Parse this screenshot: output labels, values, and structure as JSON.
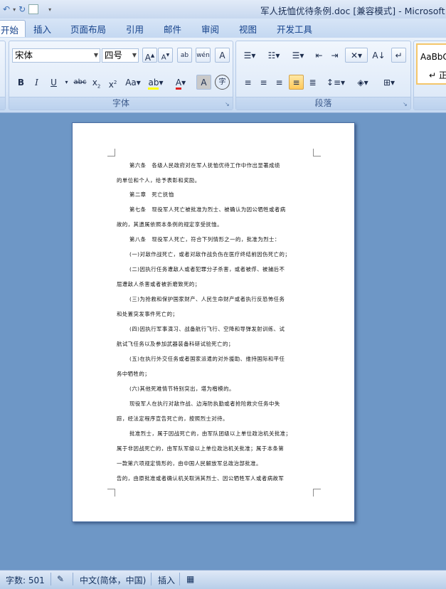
{
  "window": {
    "title": "军人抚恤优待条例.doc [兼容模式] - Microsoft W"
  },
  "tabs": [
    {
      "label": "开始"
    },
    {
      "label": "插入"
    },
    {
      "label": "页面布局"
    },
    {
      "label": "引用"
    },
    {
      "label": "邮件"
    },
    {
      "label": "审阅"
    },
    {
      "label": "视图"
    },
    {
      "label": "开发工具"
    }
  ],
  "ribbon": {
    "font_group_label": "字体",
    "paragraph_group_label": "段落",
    "font_name": "宋体",
    "font_size": "四号",
    "styles_preview": "AaBbC",
    "styles_name": "↵ 正"
  },
  "document": {
    "lines": [
      "第六条　各级人民政府对在军人抚恤优待工作中作出显著成绩",
      "的单位和个人，给予表彰和奖励。",
      "第二章　死亡抚恤",
      "第七条　现役军人死亡被批准为烈士、被确认为因公牺牲或者病",
      "故的，其遗属依照本条例的规定享受抚恤。",
      "第八条　现役军人死亡，符合下列情形之一的，批准为烈士：",
      "(一)对敌作战死亡，或者对敌作战负伤在医疗终结前因伤死亡的；",
      "(二)因执行任务遭敌人或者犯罪分子杀害，或者被俘、被捕后不",
      "屈遭敌人杀害或者被折磨致死的；",
      "(三)为抢救和保护国家财产、人民生命财产或者执行反恐怖任务",
      "和处置突发事件死亡的；",
      "(四)因执行军事演习、战备航行飞行、空降和导弹发射训练、试",
      "航试飞任务以及参加武器装备科研试验死亡的；",
      "(五)在执行外交任务或者国家派遣的对外援助、维持国际和平任",
      "务中牺牲的；",
      "(六)其他死难情节特别突出，堪为楷模的。",
      "现役军人在执行对敌作战、边海防执勤或者抢险救灾任务中失",
      "踪，经法定程序宣告死亡的，按照烈士对待。",
      "批准烈士，属于因战死亡的，由军队团级以上单位政治机关批准；",
      "属于非因战死亡的，由军队军级以上单位政治机关批准；属于本条第",
      "一款第六项规定情形的，由中国人民解放军总政治部批准。",
      "告的，由原批准或者确认机关取消其烈士、因公牺牲军人或者病故军"
    ]
  },
  "statusbar": {
    "word_count": "字数: 501",
    "language": "中文(简体，中国)",
    "mode": "插入"
  },
  "colors": {
    "accent": "#15428b",
    "background": "#6e97c6",
    "highlight": "#ffc95b"
  }
}
